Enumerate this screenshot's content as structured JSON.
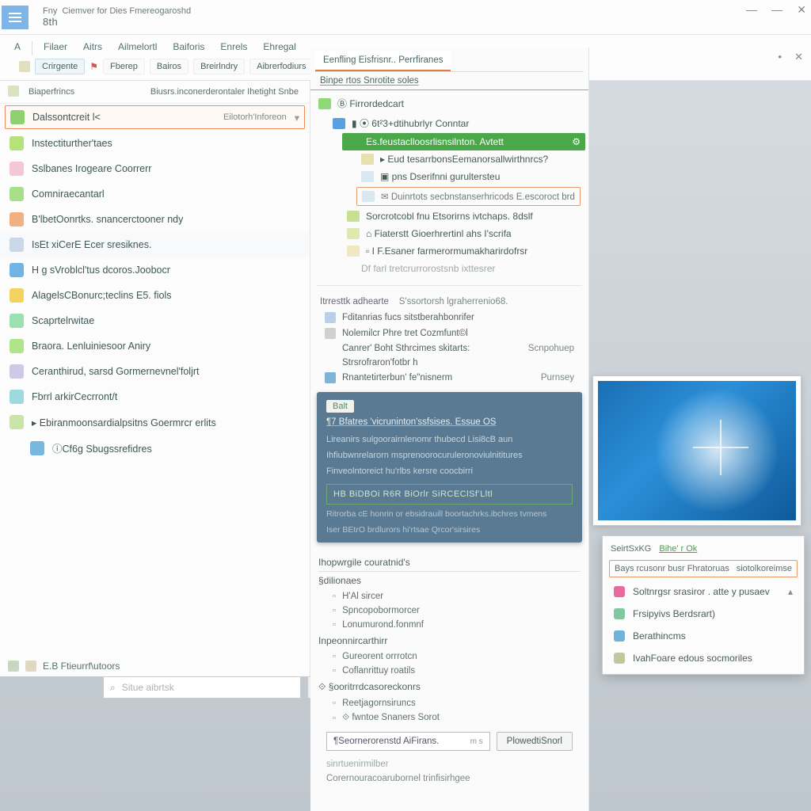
{
  "titlebar": {
    "prefix": "Fny",
    "title": "Ciemver for Dies Fmereogaroshd",
    "subtitle": "8th"
  },
  "window_controls": {
    "min": "—",
    "mid": "—",
    "close": "✕"
  },
  "menubar": {
    "row1": [
      "A",
      "Filaer",
      "Aitrs",
      "Ailmelortl",
      "Baiforis",
      "Enrels",
      "Ehregal"
    ],
    "row2": {
      "compose": "Crirgente",
      "flag_icon": "⚑",
      "items": [
        "Fberep",
        "Bairos",
        "Breirlndry",
        "Aibrerfodiurs"
      ]
    }
  },
  "leftpane": {
    "headers": [
      "Biaperfrincs",
      "Biusrs.inconerderontaler Ihetight Snbe"
    ],
    "highlight": {
      "label": "Dalssontcreit l<",
      "right": "Eilotorh'Inforeon"
    },
    "items": [
      {
        "icon": "#b6e27c",
        "label": "Instectiturther'taes"
      },
      {
        "icon": "#f5c6d8",
        "label": "Sslbanes Irogeare Coorrerr"
      },
      {
        "icon": "#a8e08a",
        "label": "Comniraecantarl"
      },
      {
        "icon": "#f0b080",
        "label": "B'lbetOonrtks. snancerctooner ndy"
      },
      {
        "icon": "#c8d8e6",
        "label": "IsEt xiCerE Ecer sresiknes.",
        "soft": true
      },
      {
        "icon": "#6fb4e4",
        "label": "H g sVroblcl'tus dcoros.Joobocr"
      },
      {
        "icon": "#f4d260",
        "label": "AlagelsCBonurc;teclins E5. fiols"
      },
      {
        "icon": "#9ce0b0",
        "label": "Scaprtelrwitae"
      },
      {
        "icon": "#b0e48a",
        "label": "Braora. Lenluiniesoor Aniry"
      },
      {
        "icon": "#d0c8e8",
        "label": "Ceranthirud, sarsd Gormernevnel'foljrt"
      },
      {
        "icon": "#a0d8e0",
        "label": "Fbrrl arkirCecrront/t"
      },
      {
        "icon": "#c8e4a8",
        "label": "▸ Ebiranmoonsardialpsitns Goermrcr erlits"
      },
      {
        "icon": "#78b8e0",
        "label": "ⓘCf6g Sbugssrefidres",
        "indent": true
      }
    ],
    "footer": "E.B Ftieurrf\\utoors"
  },
  "centerpane": {
    "tabs": [
      "Eenfling Eisfrisnr.. Perrfiranes"
    ],
    "crumb": "Binpe rtos Snrotite soles",
    "tree": [
      {
        "lvl": 0,
        "icon": "#8fd878",
        "label": "Ⓑ Firrordedcart"
      },
      {
        "lvl": 1,
        "icon": "#5aa0e0",
        "label": "▮ ⦿ 6t²3+dtihubrlyr Conntar"
      },
      {
        "lvl": 2,
        "icon": "#4aa84a",
        "label": "Es.feustaclloosrlisnsilnton.  Avtett",
        "sel": true,
        "gear": true
      },
      {
        "lvl": 3,
        "icon": "#e8e0b0",
        "label": "▸ Eud tesarrbonsEemanorsallwirthnrcs?"
      },
      {
        "lvl": 3,
        "icon": "#d8e8f0",
        "label": "▣ pns Dserifnni gurultersteu"
      },
      {
        "lvl": 4,
        "icon": "#d8e8f0",
        "label": "✉ Duinrtots secbnstanserhricods E.escoroct brd",
        "box": true
      },
      {
        "lvl": 2,
        "icon": "#c8e090",
        "label": "Sorcrotcobl fnu Etsorirns ivtchaps. 8dslf"
      },
      {
        "lvl": 2,
        "icon": "#e0e8b0",
        "label": "⌂ Fiaterstt Gioerhrertinl ahs I'scrifa"
      },
      {
        "lvl": 2,
        "icon": "#f0e8c0",
        "label": "▫ I F.Esaner farmerormumakharirdofrsr"
      },
      {
        "lvl": 3,
        "icon": "",
        "label": "Df farl tretcrurrorostsnb ixttesrer",
        "dim": true
      }
    ],
    "props_header": {
      "k": "Itrresttk adhearte",
      "v": "S'ssortorsh lgraherrenio68."
    },
    "props": [
      {
        "icon": "#b8d0e8",
        "k": "Fditanrias fucs sitstberahbonrifer"
      },
      {
        "icon": "#d0d0d0",
        "k": "Nolemilcr Phre tret Cozmfunt©l"
      },
      {
        "icon": "",
        "k": "Canrer' Boht Sthrcimes skitarts:",
        "v": "Scnpohuep"
      },
      {
        "icon": "",
        "k": "Strsrofraron'fotbr h",
        "v": ""
      },
      {
        "icon": "#7fb4d8",
        "k": "Rnantetirterbun' fe\"nisnerm",
        "v": "Purnsey"
      }
    ],
    "bluepanel": {
      "head_pill": "Balt",
      "title": "¶7 Bfatres 'vicruninton'ssfsises.  Essue OS",
      "lines": [
        "Lireanirs sulgoorairnlenomr thubecd Lisi8cB aun",
        "Ihfiubwnrelarorn msprenoorocuruleronoviulnititures",
        "Finveolntoreict hu'rlbs kersre coocbirri"
      ],
      "boxed": "HB BiDBOi R6R BiOrlr SiRCEClSf'Lltl",
      "note1": "Ritrorba cE honrin or ebsidrauill boortachrks.ibchres tvmens",
      "note2": "Iser BEtrO brdlurors hi'rtsae Qrcor'sirsires"
    },
    "lower": {
      "header": "Ihopwrgile couratnid's",
      "groups": [
        {
          "h": "§dilionaes",
          "items": [
            "H'Al sircer",
            "Spncopobormorcer",
            "Lonumurond.fonmnf"
          ]
        },
        {
          "h": "Inpeonnircarthirr",
          "items": [
            "Gureorent orrrotcn",
            "Coflanrittuy roatils"
          ]
        },
        {
          "h": "⟐ §ooritrrdcasoreckonrs",
          "items": [
            "Reetjagornsiruncs",
            "⟐ fwntoe Snaners Sorot"
          ]
        }
      ],
      "inputline": {
        "label": "¶Seornerorenstd AiFirans.",
        "suffix": "m s"
      },
      "apply": "PlowedtiSnorl",
      "footer1": "sinrtuenirmilber",
      "footer2": "Corernouracoarubornel trinfisirhgee"
    }
  },
  "searchbar": {
    "placeholder": "Situe aibrtsk"
  },
  "flyout": {
    "head": [
      "SeirtSxKG",
      "Bihe' r Ok"
    ],
    "hi": {
      "left": "Bays rcusonr busr Fhratoruas",
      "right": "siotolkoreimse"
    },
    "items": [
      {
        "icon": "#e86aa0",
        "label": "Soltnrgsr srasiror . atte y pusaev",
        "caret": true
      },
      {
        "icon": "#80c8a0",
        "label": "Frsipyivs Berdsrart)"
      },
      {
        "icon": "#6fb4d8",
        "label": "Berathincms"
      },
      {
        "icon": "#c0c8a0",
        "label": "IvahFoare edous socmoriles"
      }
    ]
  },
  "colors": {
    "accent_orange": "#e47a3f",
    "accent_green": "#4aa84a",
    "panel_blue": "#5a7a94"
  }
}
